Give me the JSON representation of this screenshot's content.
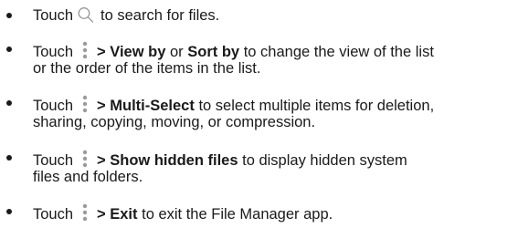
{
  "items": [
    {
      "icon": "search-icon",
      "before": "Touch",
      "after": "to search for files."
    },
    {
      "icon": "more-options-icon",
      "before": "Touch",
      "bold1": "> View by",
      "mid1": "or",
      "bold2": "Sort by",
      "after_line1": "to change the view of the list",
      "line2": "or the order of the items in the list."
    },
    {
      "icon": "more-options-icon",
      "before": "Touch",
      "bold": "> Multi-Select",
      "after_line1": "to select multiple items for deletion,",
      "line2": "sharing, copying, moving, or compression."
    },
    {
      "icon": "more-options-icon",
      "before": "Touch",
      "bold": "> Show hidden files",
      "after_line1": "to display hidden system",
      "line2": "files and folders."
    },
    {
      "icon": "more-options-icon",
      "before": "Touch",
      "bold": "> Exit",
      "after": "to exit the File Manager app."
    }
  ],
  "colors": {
    "text": "#1a1a1a",
    "icon": "#9a9a9a"
  }
}
